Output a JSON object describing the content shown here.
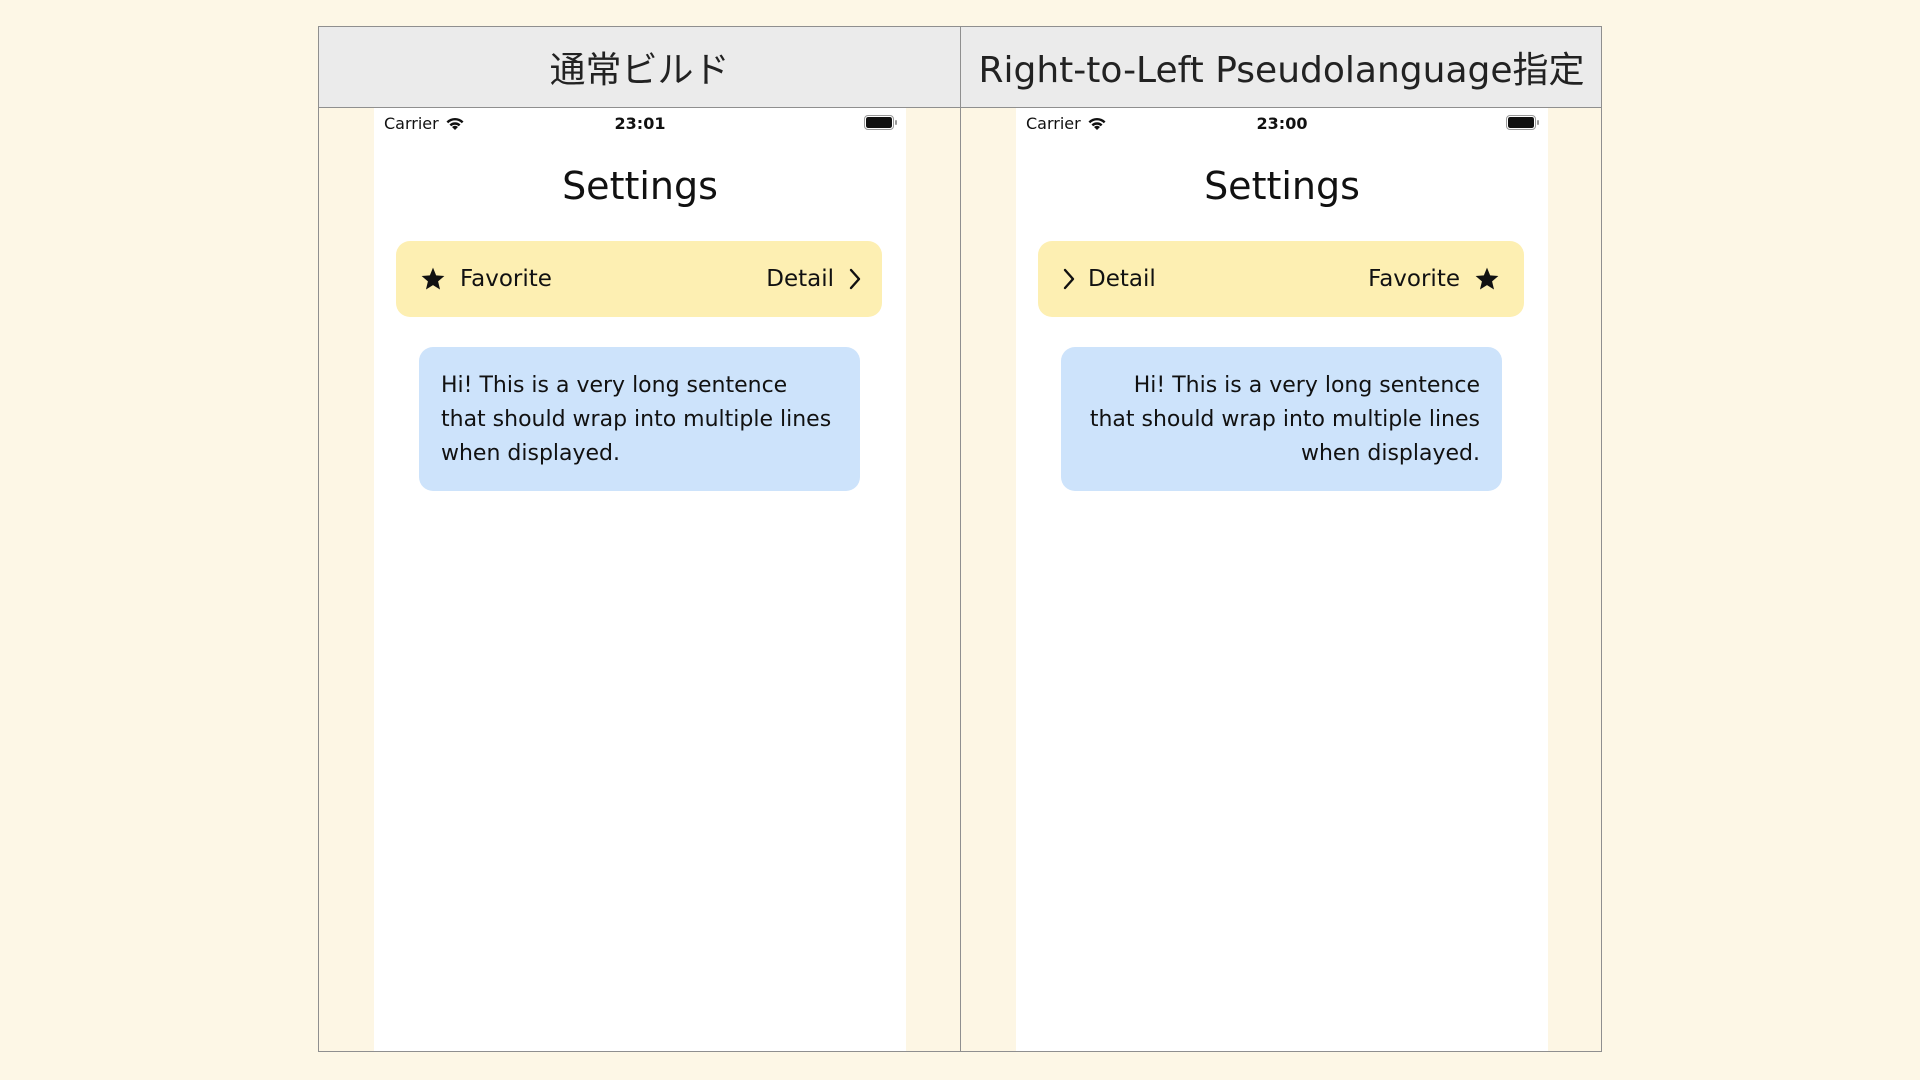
{
  "columns": [
    {
      "header": "通常ビルド",
      "status_bar": {
        "carrier": "Carrier",
        "time": "23:01"
      },
      "nav_title": "Settings",
      "favorite_label": "Favorite",
      "detail_label": "Detail",
      "message": "Hi! This is a very long sentence that should wrap into multiple lines when displayed."
    },
    {
      "header": "Right-to-Left Pseudolanguage指定",
      "status_bar": {
        "carrier": "Carrier",
        "time": "23:00"
      },
      "nav_title": "Settings",
      "favorite_label": "Favorite",
      "detail_label": "Detail",
      "message": "Hi! This is a very long sentence that should wrap into multiple lines when displayed."
    }
  ],
  "colors": {
    "background": "#fdf7e6",
    "header_bg": "#ebebeb",
    "card_bg": "#fdefb2",
    "bubble_bg": "#cde3fb"
  },
  "icons": [
    "wifi-icon",
    "battery-icon",
    "star-icon",
    "chevron-right-icon",
    "chevron-left-icon"
  ]
}
